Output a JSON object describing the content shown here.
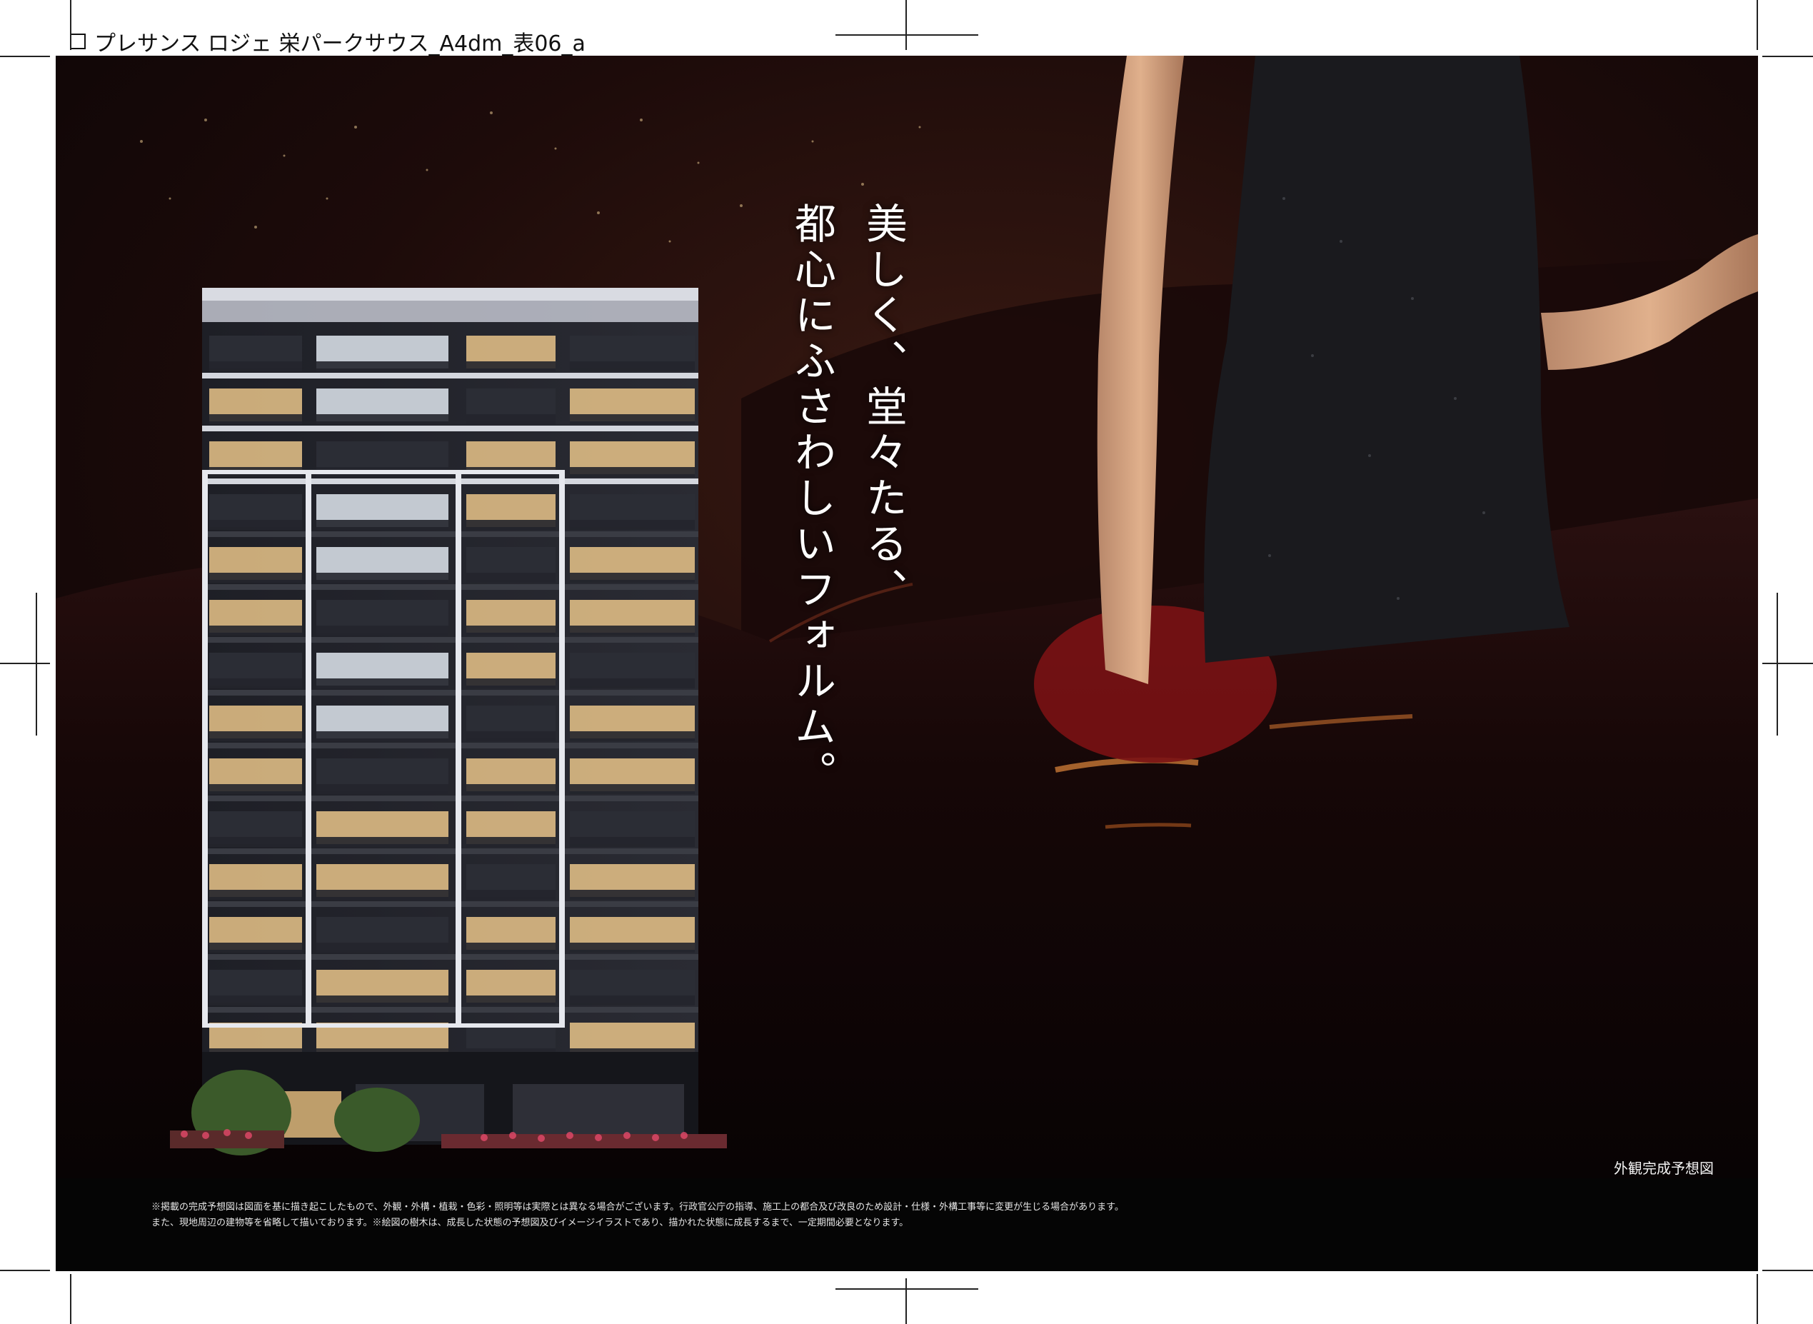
{
  "slug": {
    "text": "プレサンス ロジェ 栄パークサウス_A4dm_表06_a"
  },
  "headline": {
    "line1": "美しく、堂々たる、",
    "line2": "都心にふさわしいフォルム。"
  },
  "caption": "外観完成予想図",
  "disclaimer": {
    "line1": "※掲載の完成予想図は図面を基に描き起こしたもので、外観・外構・植栽・色彩・照明等は実際とは異なる場合がございます。行政官公庁の指導、施工上の都合及び改良のため設計・仕様・外構工事等に変更が生じる場合があります。",
    "line2": "また、現地周辺の建物等を省略して描いております。※絵図の樹木は、成長した状態の予想図及びイメージイラストであり、描かれた状態に成長するまで、一定期間必要となります。"
  },
  "colors": {
    "background": "#0f0708",
    "footer": "#050505",
    "text": "#ffffff",
    "window_light": "#f3d9a0"
  }
}
